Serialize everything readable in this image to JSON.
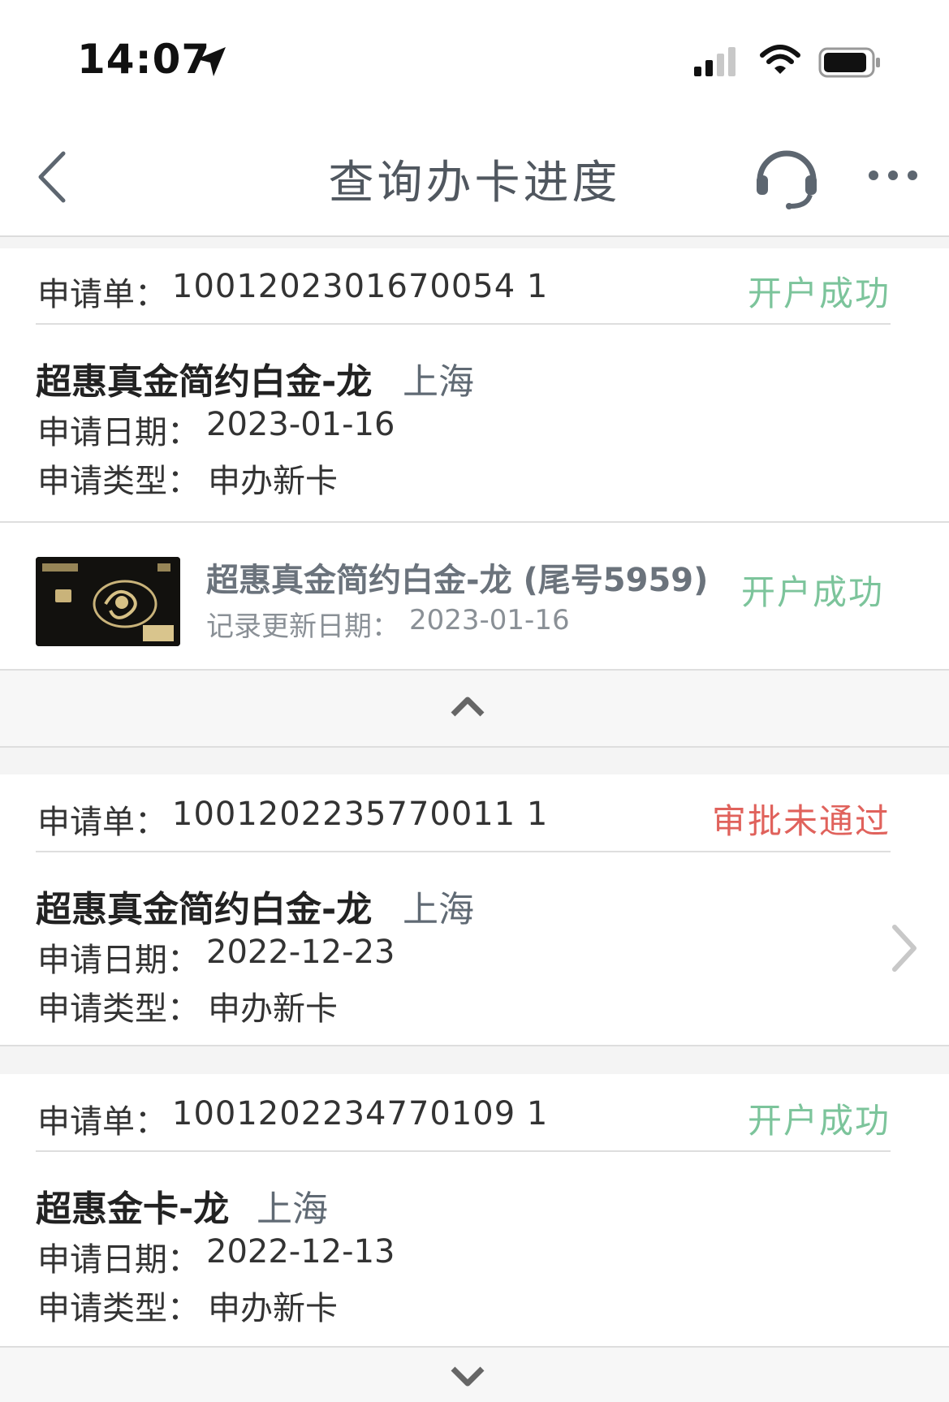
{
  "status_bar": {
    "time": "14:07"
  },
  "nav": {
    "title": "查询办卡进度"
  },
  "applications": [
    {
      "label": "申请单：",
      "number": "1001202301670054 1",
      "status": "开户成功",
      "status_color": "#7cc49b",
      "card_name": "超惠真金简约白金-龙",
      "city": "上海",
      "date_label": "申请日期：",
      "date": "2023-01-16",
      "type_label": "申请类型：",
      "type": "申办新卡",
      "detail": {
        "title": "超惠真金简约白金-龙 (尾号5959)",
        "updated_label": "记录更新日期：",
        "updated": "2023-01-16",
        "status": "开户成功"
      }
    },
    {
      "label": "申请单：",
      "number": "1001202235770011 1",
      "status": "审批未通过",
      "status_color": "#e0625c",
      "card_name": "超惠真金简约白金-龙",
      "city": "上海",
      "date_label": "申请日期：",
      "date": "2022-12-23",
      "type_label": "申请类型：",
      "type": "申办新卡"
    },
    {
      "label": "申请单：",
      "number": "1001202234770109 1",
      "status": "开户成功",
      "status_color": "#7cc49b",
      "card_name": "超惠金卡-龙",
      "city": "上海",
      "date_label": "申请日期：",
      "date": "2022-12-13",
      "type_label": "申请类型：",
      "type": "申办新卡"
    }
  ]
}
